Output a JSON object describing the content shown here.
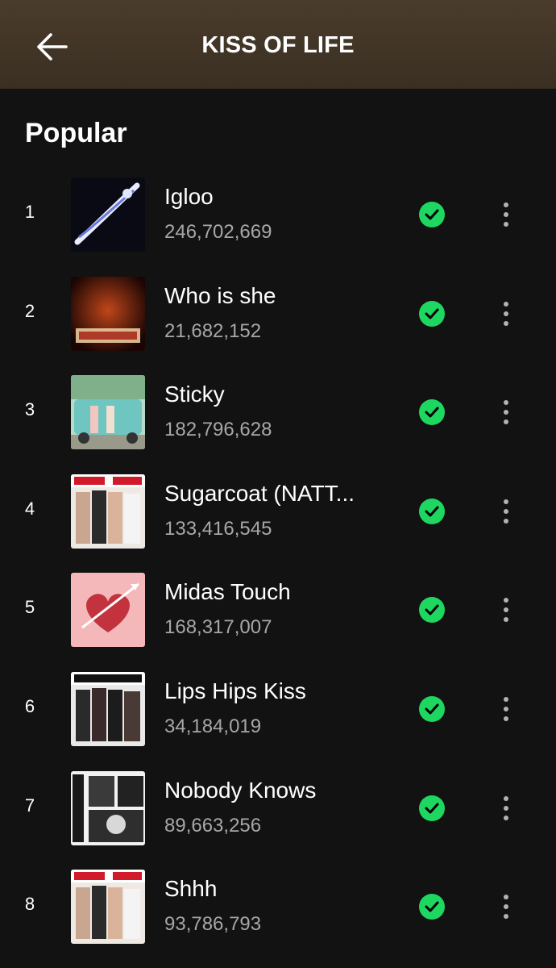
{
  "header": {
    "title": "KISS OF LIFE",
    "back_icon": "arrow-left-icon"
  },
  "section": {
    "title": "Popular"
  },
  "colors": {
    "accent": "#1ed760",
    "background": "#121212",
    "header_bg": "#3f3327",
    "secondary_text": "#a7a7a7"
  },
  "tracks": [
    {
      "rank": "1",
      "title": "Igloo",
      "plays": "246,702,669",
      "saved": true
    },
    {
      "rank": "2",
      "title": "Who is she",
      "plays": "21,682,152",
      "saved": true
    },
    {
      "rank": "3",
      "title": "Sticky",
      "plays": "182,796,628",
      "saved": true
    },
    {
      "rank": "4",
      "title": "Sugarcoat (NATT...",
      "plays": "133,416,545",
      "saved": true
    },
    {
      "rank": "5",
      "title": "Midas Touch",
      "plays": "168,317,007",
      "saved": true
    },
    {
      "rank": "6",
      "title": "Lips Hips Kiss",
      "plays": "34,184,019",
      "saved": true
    },
    {
      "rank": "7",
      "title": "Nobody Knows",
      "plays": "89,663,256",
      "saved": true
    },
    {
      "rank": "8",
      "title": "Shhh",
      "plays": "93,786,793",
      "saved": true
    }
  ]
}
